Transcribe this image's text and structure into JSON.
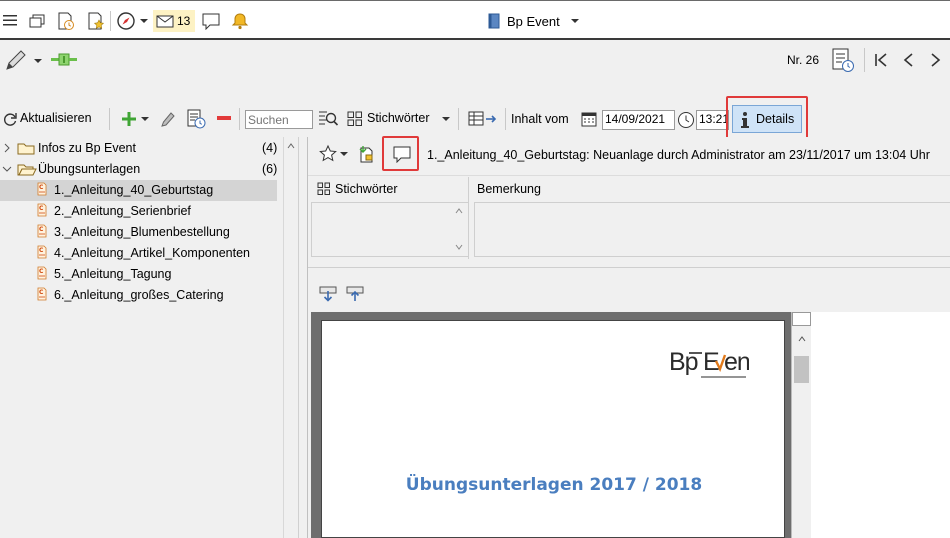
{
  "topbar": {
    "mail_count": "13",
    "app_title": "Bp Event"
  },
  "secbar": {
    "record_number": "Nr. 26"
  },
  "toolbar": {
    "refresh_label": "Aktualisieren",
    "search_placeholder": "Suchen",
    "keywords_label": "Stichwörter",
    "content_from_label": "Inhalt vom",
    "date_value": "14/09/2021",
    "time_value": "13:21",
    "details_label": "Details"
  },
  "tree": {
    "items": [
      {
        "label": "Infos zu Bp Event",
        "count": "(4)"
      },
      {
        "label": "Übungsunterlagen",
        "count": "(6)"
      }
    ],
    "files": [
      {
        "label": "1._Anleitung_40_Geburtstag"
      },
      {
        "label": "2._Anleitung_Serienbrief"
      },
      {
        "label": "3._Anleitung_Blumenbestellung"
      },
      {
        "label": "4._Anleitung_Artikel_Komponenten"
      },
      {
        "label": "5._Anleitung_Tagung"
      },
      {
        "label": "6._Anleitung_großes_Catering"
      }
    ]
  },
  "detail": {
    "doc_info": "1._Anleitung_40_Geburtstag: Neuanlage durch Administrator am 23/11/2017 um 13:04 Uhr",
    "keywords_header": "Stichwörter",
    "remarks_header": "Bemerkung"
  },
  "document": {
    "logo_text": "BpEvent",
    "heading": "Übungsunterlagen 2017 / 2018"
  },
  "colors": {
    "accent": "#4a7ebf",
    "highlight": "#e03a3a",
    "selected_row": "#d4d4d4",
    "details_button": "#cfe3f7",
    "mail_bg": "#fdf2c4"
  }
}
